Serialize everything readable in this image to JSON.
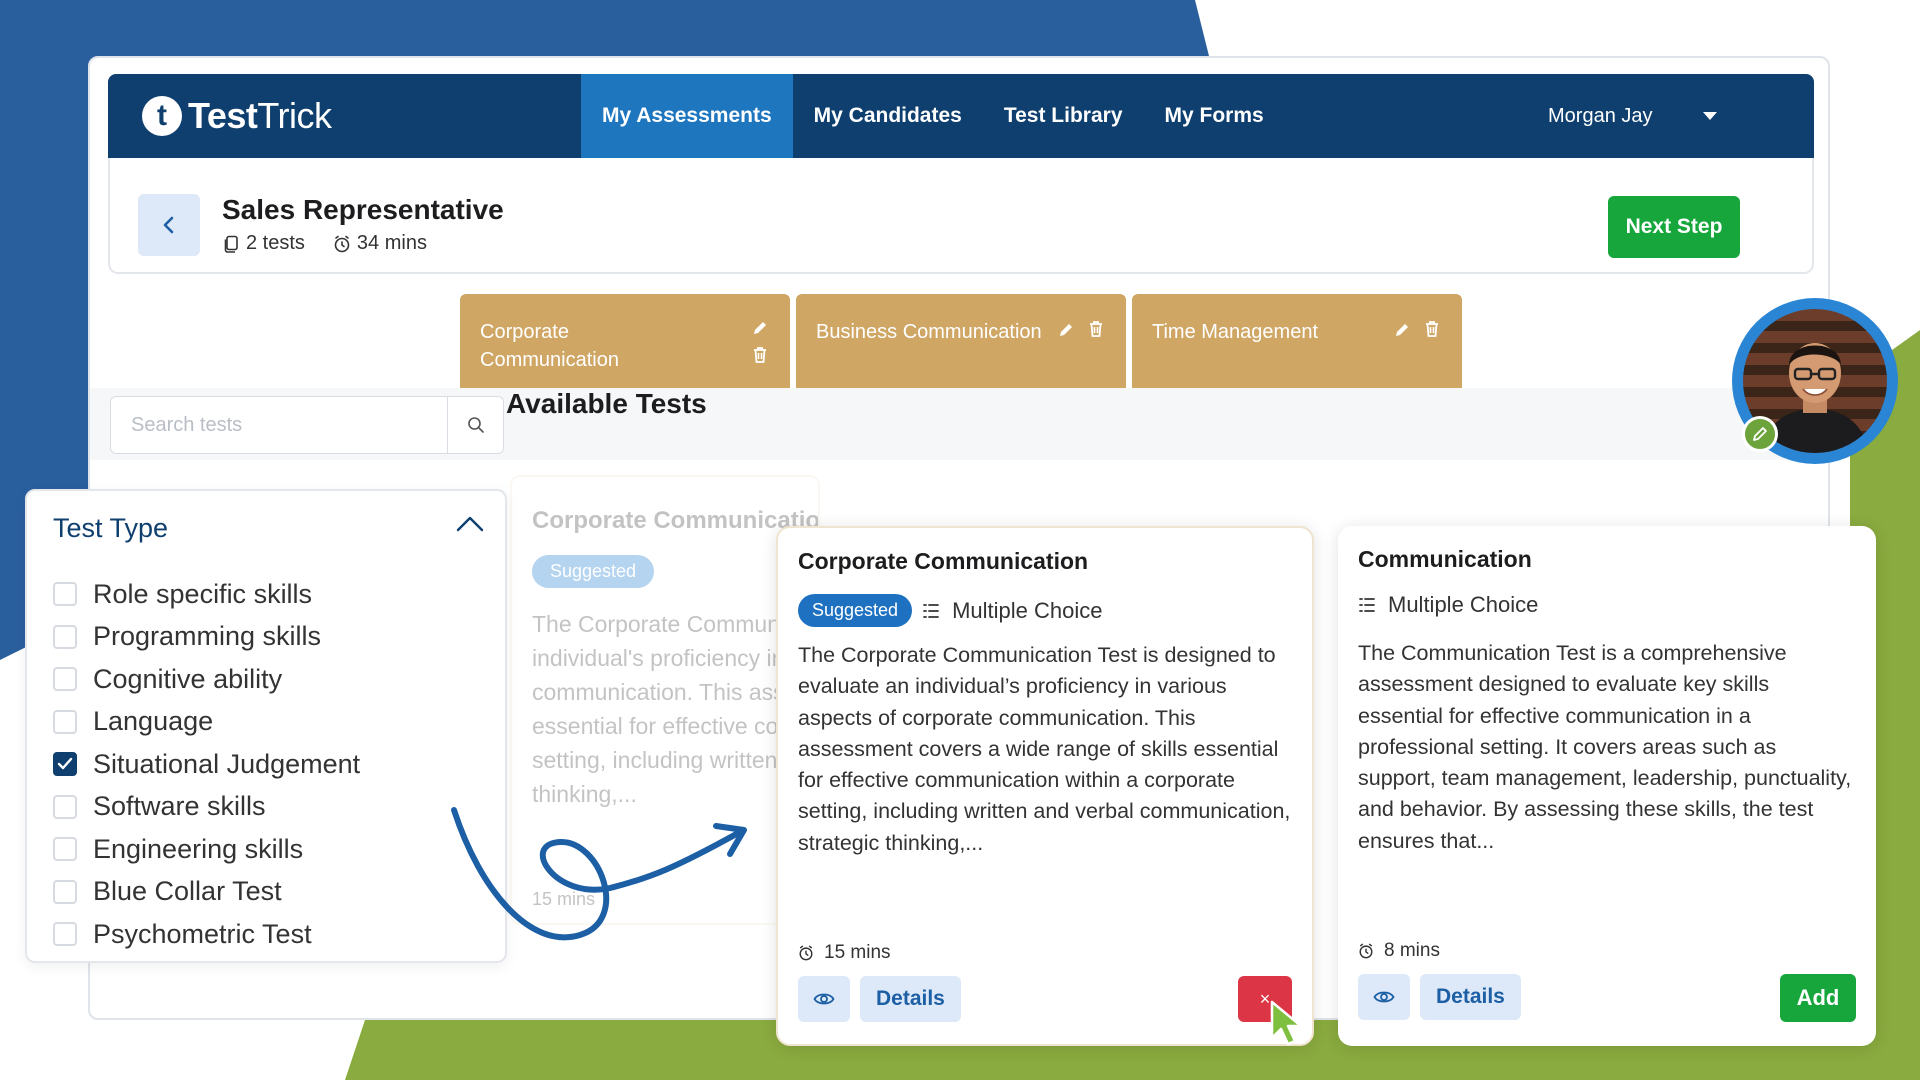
{
  "brand": {
    "mark": "t",
    "name_bold": "Test",
    "name_regular": "Trick"
  },
  "nav": {
    "tabs": [
      {
        "label": "My Assessments",
        "active": true
      },
      {
        "label": "My Candidates",
        "active": false
      },
      {
        "label": "Test Library",
        "active": false
      },
      {
        "label": "My Forms",
        "active": false
      }
    ],
    "user": "Morgan Jay"
  },
  "header": {
    "title": "Sales Representative",
    "tests_count": "2 tests",
    "duration": "34 mins",
    "next_label": "Next Step"
  },
  "selected_tests": [
    {
      "name": "Corporate Communication"
    },
    {
      "name": "Business Communication"
    },
    {
      "name": "Time Management"
    }
  ],
  "search": {
    "placeholder": "Search tests"
  },
  "available_title": "Available Tests",
  "filter": {
    "title": "Test Type",
    "items": [
      {
        "label": "Role specific skills",
        "checked": false
      },
      {
        "label": "Programming skills",
        "checked": false
      },
      {
        "label": "Cognitive ability",
        "checked": false
      },
      {
        "label": "Language",
        "checked": false
      },
      {
        "label": "Situational Judgement",
        "checked": true
      },
      {
        "label": "Software skills",
        "checked": false
      },
      {
        "label": "Engineering skills",
        "checked": false
      },
      {
        "label": "Blue Collar Test",
        "checked": false
      },
      {
        "label": "Psychometric Test",
        "checked": false
      }
    ]
  },
  "ghost_card": {
    "title": "Corporate Communication",
    "badge": "Suggested",
    "description": "The Corporate Communication Test is designed to evaluate an individual's proficiency in various aspects of corporate communication. This assessment covers a wide range of skills essential for effective communication within a corporate setting, including written and verbal communication, strategic thinking,...",
    "time": "15 mins"
  },
  "cards": [
    {
      "title": "Corporate Communication",
      "badge": "Suggested",
      "question_type": "Multiple Choice",
      "description": "The Corporate Communication Test is designed to evaluate an individual’s proficiency in various aspects of corporate communication. This assessment covers a wide range of skills essential for effective communication within a corporate setting, including written and verbal communication, strategic thinking,...",
      "time": "15 mins",
      "details_label": "Details",
      "remove_label": "×"
    },
    {
      "title": "Communication",
      "question_type": "Multiple Choice",
      "description": "The Communication Test is a comprehensive assessment designed to evaluate key skills essential for effective communication in a professional setting. It covers areas such as support, team management, leadership, punctuality, and behavior. By assessing these skills, the test ensures that...",
      "time": "8 mins",
      "details_label": "Details",
      "add_label": "Add"
    }
  ],
  "colors": {
    "navy": "#0e3f6e",
    "active_tab": "#1e76bf",
    "selected_card": "#d0a665",
    "success": "#17a63c",
    "danger": "#dc3545",
    "bg_blue": "#2a5f9e",
    "bg_green": "#8aab3f"
  }
}
